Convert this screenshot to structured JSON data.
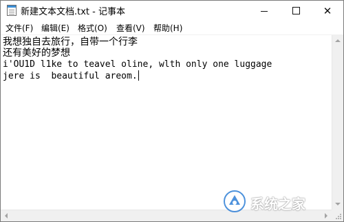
{
  "window": {
    "title": "新建文本文档.txt - 记事本",
    "icon": "notepad-icon",
    "controls": {
      "minimize_icon": "minimize-icon",
      "maximize_icon": "maximize-icon",
      "close_label": "✕"
    }
  },
  "menubar": {
    "items": [
      {
        "label": "文件(F)"
      },
      {
        "label": "编辑(E)"
      },
      {
        "label": "格式(O)"
      },
      {
        "label": "查看(V)"
      },
      {
        "label": "帮助(H)"
      }
    ]
  },
  "editor": {
    "lines": [
      "我想独自去旅行，自带一个行李",
      "还有美好的梦想",
      "i'OU1D l1ke to teavel oline, wlth only one luggage",
      "jere is  beautiful areom."
    ]
  },
  "scrollbars": {
    "vertical": "vertical-scrollbar",
    "horizontal": "horizontal-scrollbar"
  },
  "watermark": {
    "brand": "系统之家",
    "logo": "xitongzhijia-logo",
    "accent_color": "#2f7fd6"
  }
}
